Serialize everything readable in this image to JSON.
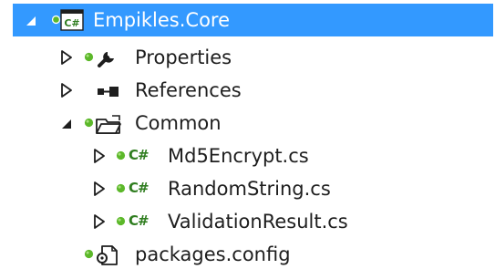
{
  "tree": {
    "root": {
      "label": "Empikles.Core",
      "icon": "csharp-project-icon",
      "expanded": true,
      "selected": true
    },
    "items": [
      {
        "label": "Properties",
        "icon": "wrench-icon",
        "expanded": false
      },
      {
        "label": "References",
        "icon": "references-icon",
        "expanded": false
      },
      {
        "label": "Common",
        "icon": "open-folder-icon",
        "expanded": true
      },
      {
        "label": "Md5Encrypt.cs",
        "icon": "csharp-file-icon",
        "icon_text": "C#",
        "expanded": false
      },
      {
        "label": "RandomString.cs",
        "icon": "csharp-file-icon",
        "icon_text": "C#",
        "expanded": false
      },
      {
        "label": "ValidationResult.cs",
        "icon": "csharp-file-icon",
        "icon_text": "C#",
        "expanded": false
      },
      {
        "label": "packages.config",
        "icon": "config-file-icon"
      }
    ]
  },
  "colors": {
    "selection": "#3399ff",
    "text": "#1e1e1e",
    "selected_text": "#ffffff",
    "source_control_dot": "#5cb82a",
    "csharp_green": "#2f7d1f"
  }
}
